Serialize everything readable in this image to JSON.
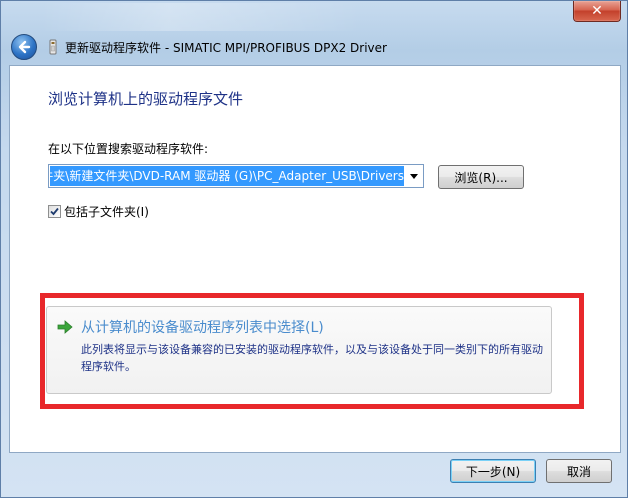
{
  "window": {
    "title": "更新驱动程序软件 - SIMATIC MPI/PROFIBUS DPX2 Driver",
    "close_label": "✕"
  },
  "main": {
    "heading": "浏览计算机上的驱动程序文件",
    "search_label": "在以下位置搜索驱动程序软件:",
    "path_value": "C:\\Users\\Administrator\\Desktop\\新建文件夹\\新建文件夹\\DVD-RAM 驱动器 (G)\\PC_Adapter_USB\\Drivers",
    "browse_button": "浏览(R)...",
    "include_subfolders_label": "包括子文件夹(I)",
    "include_subfolders_checked": true
  },
  "option": {
    "title": "从计算机的设备驱动程序列表中选择(L)",
    "description": "此列表将显示与该设备兼容的已安装的驱动程序软件，以及与该设备处于同一类别下的所有驱动程序软件。"
  },
  "footer": {
    "next_button": "下一步(N)",
    "cancel_button": "取消"
  },
  "colors": {
    "heading": "#1e3287",
    "option_title": "#4a8ccd",
    "selection": "#3399ff",
    "highlight_border": "#e8282b"
  }
}
